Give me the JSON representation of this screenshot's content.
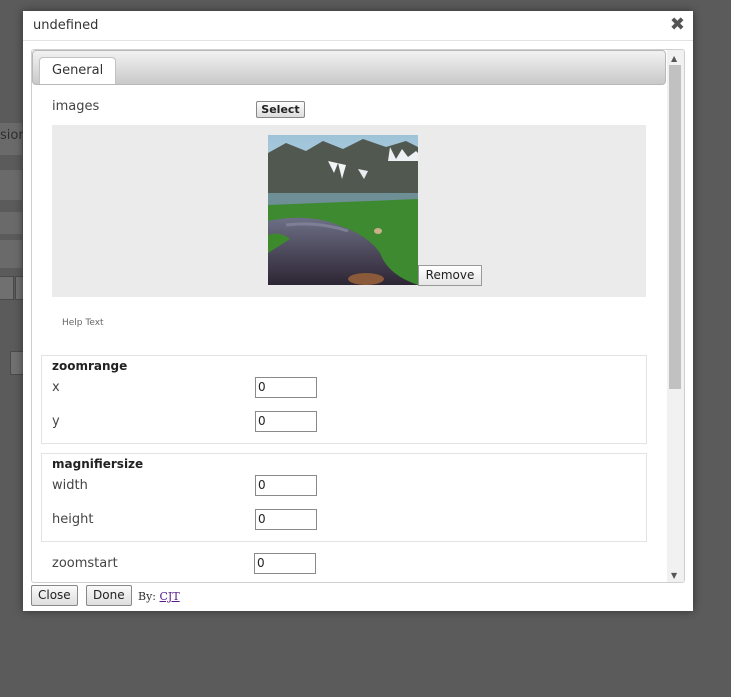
{
  "background": {
    "partial_text": "sion"
  },
  "dialog": {
    "title": "undefined",
    "close_glyph": "✖"
  },
  "tabs": [
    {
      "label": "General",
      "active": true
    }
  ],
  "images": {
    "label": "images",
    "select_label": "Select",
    "remove_label": "Remove",
    "help_text": "Help Text"
  },
  "zoomrange": {
    "title": "zoomrange",
    "x_label": "x",
    "x_value": "0",
    "y_label": "y",
    "y_value": "0"
  },
  "magnifiersize": {
    "title": "magnifiersize",
    "width_label": "width",
    "width_value": "0",
    "height_label": "height",
    "height_value": "0"
  },
  "zoomstart": {
    "label": "zoomstart",
    "value": "0"
  },
  "footer": {
    "close_label": "Close",
    "done_label": "Done",
    "by_prefix": "By:",
    "by_link": "CJT"
  },
  "colors": {
    "overlay": "#5b5b5b",
    "tab_gradient_top": "#f2f2f2",
    "tab_gradient_bottom": "#c9c9c9",
    "link": "#551a8b"
  }
}
